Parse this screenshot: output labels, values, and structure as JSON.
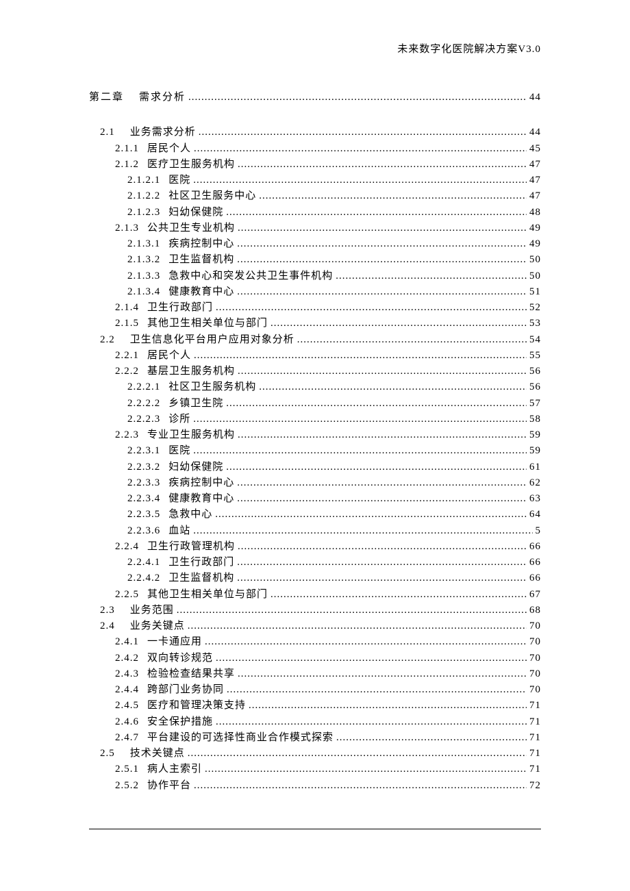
{
  "header_title": "未来数字化医院解决方案V3.0",
  "toc": [
    {
      "num": "第二章",
      "title": "需求分析",
      "page": "44",
      "level": 0
    },
    {
      "num": "2.1",
      "title": "业务需求分析",
      "page": "44",
      "level": 1
    },
    {
      "num": "2.1.1",
      "title": "居民个人",
      "page": "45",
      "level": 2
    },
    {
      "num": "2.1.2",
      "title": "医疗卫生服务机构",
      "page": "47",
      "level": 2
    },
    {
      "num": "2.1.2.1",
      "title": "医院",
      "page": "47",
      "level": 3
    },
    {
      "num": "2.1.2.2",
      "title": "社区卫生服务中心",
      "page": "47",
      "level": 3
    },
    {
      "num": "2.1.2.3",
      "title": "妇幼保健院",
      "page": "48",
      "level": 3
    },
    {
      "num": "2.1.3",
      "title": "公共卫生专业机构",
      "page": "49",
      "level": 2
    },
    {
      "num": "2.1.3.1",
      "title": "疾病控制中心",
      "page": "49",
      "level": 3
    },
    {
      "num": "2.1.3.2",
      "title": "卫生监督机构",
      "page": "50",
      "level": 3
    },
    {
      "num": "2.1.3.3",
      "title": "急救中心和突发公共卫生事件机构",
      "page": "50",
      "level": 3
    },
    {
      "num": "2.1.3.4",
      "title": "健康教育中心",
      "page": "51",
      "level": 3
    },
    {
      "num": "2.1.4",
      "title": "卫生行政部门",
      "page": "52",
      "level": 2
    },
    {
      "num": "2.1.5",
      "title": "其他卫生相关单位与部门",
      "page": "53",
      "level": 2
    },
    {
      "num": "2.2",
      "title": "卫生信息化平台用户应用对象分析",
      "page": "54",
      "level": 1
    },
    {
      "num": "2.2.1",
      "title": "居民个人",
      "page": "55",
      "level": 2
    },
    {
      "num": "2.2.2",
      "title": "基层卫生服务机构",
      "page": "56",
      "level": 2
    },
    {
      "num": "2.2.2.1",
      "title": "社区卫生服务机构",
      "page": "56",
      "level": 3
    },
    {
      "num": "2.2.2.2",
      "title": "乡镇卫生院",
      "page": "57",
      "level": 3
    },
    {
      "num": "2.2.2.3",
      "title": "诊所",
      "page": "58",
      "level": 3
    },
    {
      "num": "2.2.3",
      "title": "专业卫生服务机构",
      "page": "59",
      "level": 2
    },
    {
      "num": "2.2.3.1",
      "title": "医院",
      "page": "59",
      "level": 3
    },
    {
      "num": "2.2.3.2",
      "title": "妇幼保健院",
      "page": "61",
      "level": 3
    },
    {
      "num": "2.2.3.3",
      "title": "疾病控制中心",
      "page": "62",
      "level": 3
    },
    {
      "num": "2.2.3.4",
      "title": "健康教育中心",
      "page": "63",
      "level": 3
    },
    {
      "num": "2.2.3.5",
      "title": "急救中心",
      "page": "64",
      "level": 3
    },
    {
      "num": "2.2.3.6",
      "title": "血站",
      "page": "5",
      "level": 3
    },
    {
      "num": "2.2.4",
      "title": "卫生行政管理机构",
      "page": "66",
      "level": 2
    },
    {
      "num": "2.2.4.1",
      "title": "卫生行政部门",
      "page": "66",
      "level": 3
    },
    {
      "num": "2.2.4.2",
      "title": "卫生监督机构",
      "page": "66",
      "level": 3
    },
    {
      "num": "2.2.5",
      "title": "其他卫生相关单位与部门",
      "page": "67",
      "level": 2
    },
    {
      "num": "2.3",
      "title": "业务范围",
      "page": "68",
      "level": 1
    },
    {
      "num": "2.4",
      "title": "业务关键点",
      "page": "70",
      "level": 1
    },
    {
      "num": "2.4.1",
      "title": "一卡通应用",
      "page": "70",
      "level": 2
    },
    {
      "num": "2.4.2",
      "title": "双向转诊规范",
      "page": "70",
      "level": 2
    },
    {
      "num": "2.4.3",
      "title": "检验检查结果共享",
      "page": "70",
      "level": 2
    },
    {
      "num": "2.4.4",
      "title": "跨部门业务协同",
      "page": "70",
      "level": 2
    },
    {
      "num": "2.4.5",
      "title": "医疗和管理决策支持",
      "page": "71",
      "level": 2
    },
    {
      "num": "2.4.6",
      "title": "安全保护措施",
      "page": "71",
      "level": 2
    },
    {
      "num": "2.4.7",
      "title": "平台建设的可选择性商业合作模式探索",
      "page": "71",
      "level": 2
    },
    {
      "num": "2.5",
      "title": "技术关键点",
      "page": "71",
      "level": 1
    },
    {
      "num": "2.5.1",
      "title": "病人主索引",
      "page": "71",
      "level": 2
    },
    {
      "num": "2.5.2",
      "title": "协作平台",
      "page": "72",
      "level": 2
    }
  ]
}
